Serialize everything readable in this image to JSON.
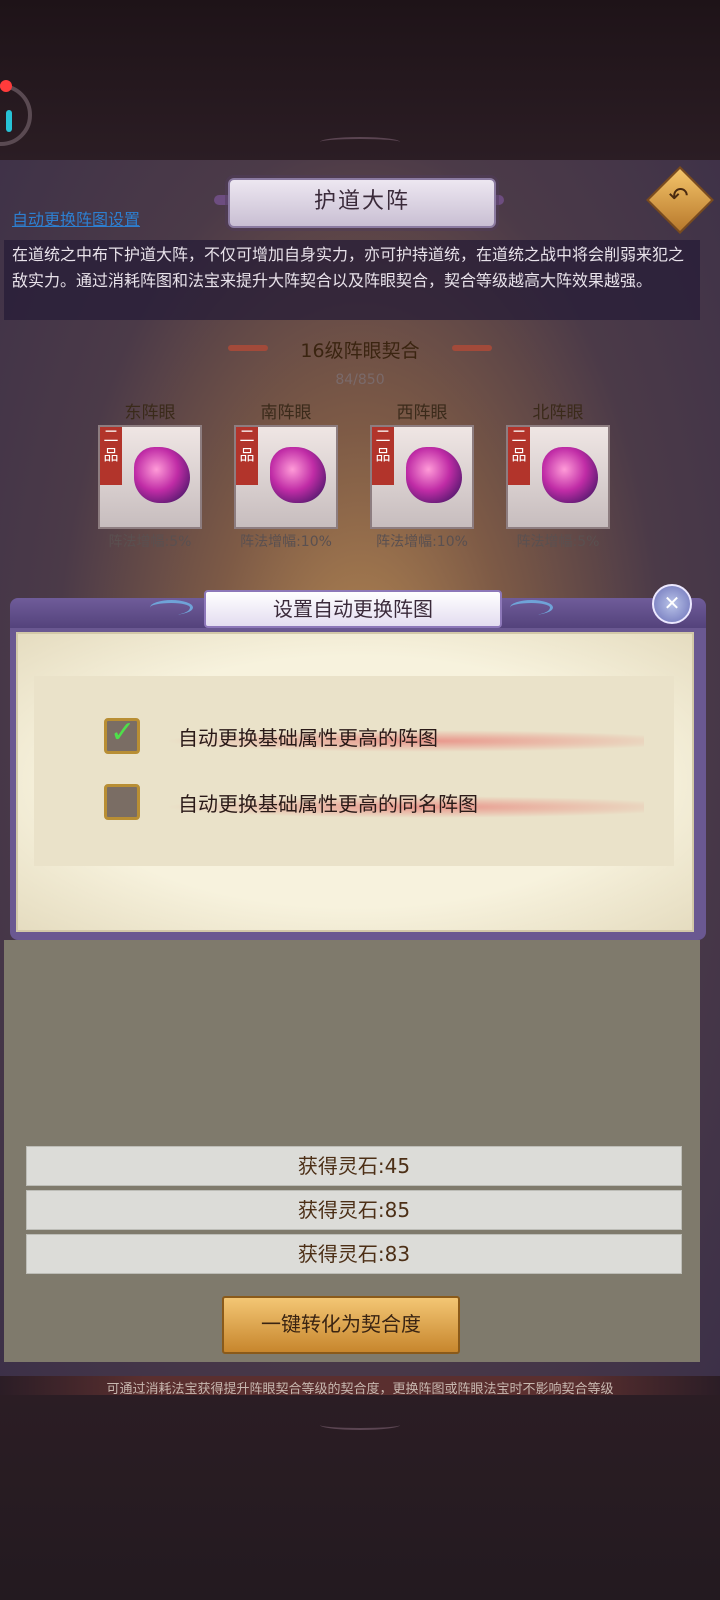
{
  "header": {
    "title": "护道大阵",
    "auto_link": "自动更换阵图设置",
    "description": "在道统之中布下护道大阵，不仅可增加自身实力，亦可护持道统，在道统之战中将会削弱来犯之敌实力。通过消耗阵图和法宝来提升大阵契合以及阵眼契合，契合等级越高大阵效果越强。"
  },
  "level": {
    "title": "16级阵眼契合",
    "progress": "84/850"
  },
  "eyes": [
    {
      "name": "东阵眼",
      "grade": "二品",
      "bonus": "阵法增幅:5%"
    },
    {
      "name": "南阵眼",
      "grade": "二品",
      "bonus": "阵法增幅:10%"
    },
    {
      "name": "西阵眼",
      "grade": "二品",
      "bonus": "阵法增幅:10%"
    },
    {
      "name": "北阵眼",
      "grade": "二品",
      "bonus": "阵法增幅:5%"
    }
  ],
  "dialog": {
    "title": "设置自动更换阵图",
    "options": [
      {
        "label": "自动更换基础属性更高的阵图",
        "checked": true
      },
      {
        "label": "自动更换基础属性更高的同名阵图",
        "checked": false
      }
    ]
  },
  "rewards": [
    "获得灵石:45",
    "获得灵石:85",
    "获得灵石:83"
  ],
  "convert_button": "一键转化为契合度",
  "footer_note": "可通过消耗法宝获得提升阵眼契合等级的契合度，更换阵图或阵眼法宝时不影响契合等级",
  "icons": {
    "back": "back-arrow-icon",
    "close": "close-icon",
    "check": "check-icon"
  },
  "colors": {
    "accent_gold": "#c7862d",
    "link_blue": "#2d7fd0",
    "grade_red": "#b2342b",
    "dialog_purple": "#6a5891"
  }
}
